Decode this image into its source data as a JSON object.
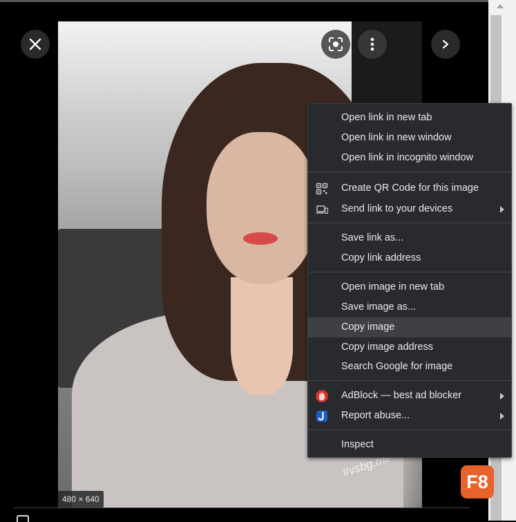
{
  "image": {
    "dimensions_label": "480 × 640",
    "watermark": "#vsbg.me"
  },
  "viewer_controls": {
    "close_icon": "close-icon",
    "lens_icon": "google-lens-icon",
    "more_icon": "more-vert-icon",
    "next_icon": "chevron-right-icon"
  },
  "context_menu": {
    "groups": [
      [
        "Open link in new tab",
        "Open link in new window",
        "Open link in incognito window"
      ],
      [
        "Create QR Code for this image",
        "Send link to your devices"
      ],
      [
        "Save link as...",
        "Copy link address"
      ],
      [
        "Open image in new tab",
        "Save image as...",
        "Copy image",
        "Copy image address",
        "Search Google for image"
      ],
      [
        "AdBlock — best ad blocker",
        "Report abuse..."
      ],
      [
        "Inspect"
      ]
    ],
    "highlighted": "Copy image"
  },
  "overlay_badge": {
    "label": "F8",
    "color": "#e8622b"
  },
  "colors": {
    "menu_bg": "#292a2d",
    "menu_text": "#e8eaed",
    "highlight": "#3f4043",
    "adblock_red": "#e0342b",
    "report_blue": "#1a5cc8"
  }
}
